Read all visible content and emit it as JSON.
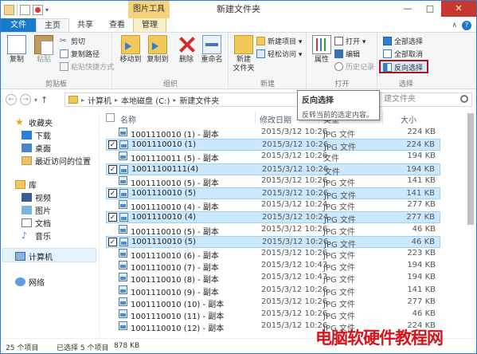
{
  "window": {
    "title": "新建文件夹",
    "context_tab_header": "图片工具",
    "controls": {
      "minimize": "—",
      "maximize": "□",
      "close": "✕"
    }
  },
  "tabs": {
    "file": "文件",
    "home": "主页",
    "share": "共享",
    "view": "查看",
    "manage": "管理",
    "collapse": "∧",
    "help": "?"
  },
  "ribbon": {
    "clipboard": {
      "label": "剪贴板",
      "copy": "复制",
      "paste": "粘贴",
      "cut": "剪切",
      "copy_path": "复制路径",
      "paste_shortcut": "粘贴快捷方式"
    },
    "organize": {
      "label": "组织",
      "move_to": "移动到",
      "copy_to": "复制到",
      "delete": "删除",
      "rename": "重命名"
    },
    "new": {
      "label": "新建",
      "new_folder": "新建\n文件夹",
      "new_item": "新建项目 ▾",
      "easy_access": "轻松访问 ▾"
    },
    "open": {
      "label": "打开",
      "properties": "属性",
      "open": "打开 ▾",
      "edit": "编辑",
      "history": "历史记录"
    },
    "select": {
      "label": "选择",
      "select_all": "全部选择",
      "select_none": "全部取消",
      "invert_selection": "反向选择"
    }
  },
  "address": {
    "back": "←",
    "forward": "→",
    "up": "↑",
    "crumbs": [
      "计算机",
      "本地磁盘 (C:)",
      "新建文件夹"
    ],
    "search_placeholder": "建文件夹"
  },
  "tooltip": {
    "title": "反向选择",
    "description": "反转当前的选定内容。"
  },
  "nav_pane": {
    "favorites": "收藏夹",
    "downloads": "下载",
    "desktop": "桌面",
    "recent": "最近访问的位置",
    "libraries": "库",
    "videos": "视频",
    "pictures": "图片",
    "documents": "文档",
    "music": "音乐",
    "computer": "计算机",
    "network": "网络"
  },
  "columns": {
    "name": "名称",
    "date": "修改日期",
    "type": "类型",
    "size": "大小"
  },
  "files": [
    {
      "name": "1001110010 (1) - 副本",
      "date": "2015/3/12 10:26",
      "type": "JPG 文件",
      "size": "224 KB",
      "selected": false
    },
    {
      "name": "1001110010 (1)",
      "date": "2015/3/12 10:26",
      "type": "JPG 文件",
      "size": "224 KB",
      "selected": true
    },
    {
      "name": "1001110011 (5) - 副本",
      "date": "2015/3/12 10:26",
      "type": "文件",
      "size": "194 KB",
      "selected": false
    },
    {
      "name": "10011100111(4)",
      "date": "2015/3/12 10:26",
      "type": "文件",
      "size": "194 KB",
      "selected": true
    },
    {
      "name": "1001110010 (5) - 副本",
      "date": "2015/3/12 10:26",
      "type": "JPG 文件",
      "size": "141 KB",
      "selected": false
    },
    {
      "name": "1001110010 (5)",
      "date": "2015/3/12 10:26",
      "type": "JPG 文件",
      "size": "141 KB",
      "selected": true
    },
    {
      "name": "1001110010 (4) - 副本",
      "date": "2015/3/12 10:24",
      "type": "JPG 文件",
      "size": "277 KB",
      "selected": false
    },
    {
      "name": "1001110010 (4)",
      "date": "2015/3/12 10:24",
      "type": "JPG 文件",
      "size": "277 KB",
      "selected": true
    },
    {
      "name": "1001110010 (5) - 副本",
      "date": "2015/3/12 10:26",
      "type": "JPG 文件",
      "size": "46 KB",
      "selected": false
    },
    {
      "name": "1001110010 (5)",
      "date": "2015/3/12 10:26",
      "type": "JPG 文件",
      "size": "46 KB",
      "selected": true
    },
    {
      "name": "1001110010 (6) - 副本",
      "date": "2015/3/12 10:26",
      "type": "JPG 文件",
      "size": "223 KB",
      "selected": false
    },
    {
      "name": "1001110010 (7) - 副本",
      "date": "2015/3/12 10:43",
      "type": "JPG 文件",
      "size": "194 KB",
      "selected": false
    },
    {
      "name": "1001110010 (8) - 副本",
      "date": "2015/3/12 10:43",
      "type": "JPG 文件",
      "size": "194 KB",
      "selected": false
    },
    {
      "name": "1001110010 (9) - 副本",
      "date": "2015/3/12 10:26",
      "type": "JPG 文件",
      "size": "141 KB",
      "selected": false
    },
    {
      "name": "1001110010 (10) - 副本",
      "date": "2015/3/12 10:26",
      "type": "JPG 文件",
      "size": "277 KB",
      "selected": false
    },
    {
      "name": "1001110010 (11) - 副本",
      "date": "2015/3/12 10:26",
      "type": "JPG 文件",
      "size": "46 KB",
      "selected": false
    },
    {
      "name": "1001110010 (12) - 副本",
      "date": "2015/3/12 10:26",
      "type": "JPG 文件",
      "size": "224 KB",
      "selected": false
    }
  ],
  "status": {
    "count": "25 个项目",
    "selected": "已选择 5 个项目",
    "selected_size": "878 KB"
  },
  "watermark": "电脑软硬件教程网",
  "colors": {
    "accent": "#1979ca",
    "selection": "#cce8ff",
    "context_tab": "#f6d37a",
    "highlight_box": "#b3121b",
    "watermark": "#d8121b"
  }
}
